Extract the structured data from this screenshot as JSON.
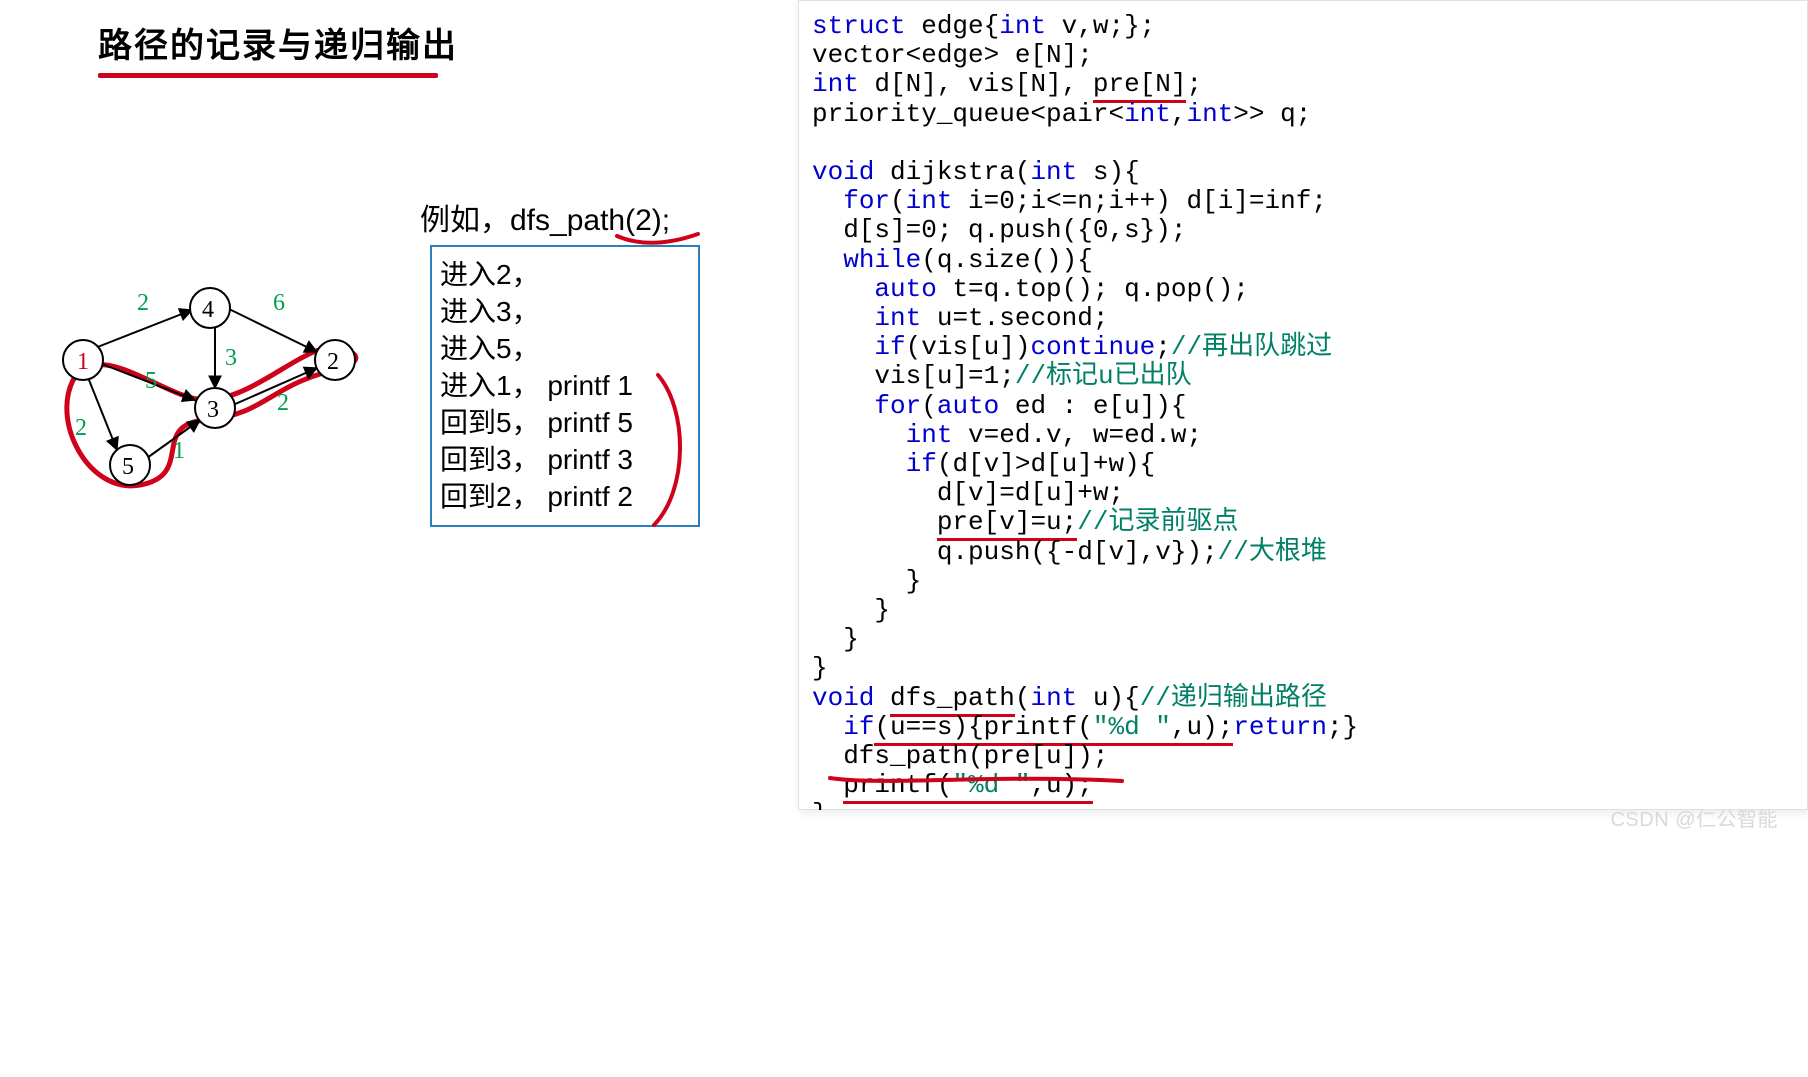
{
  "title": "路径的记录与递归输出",
  "example_label": "例如，dfs_path(2);",
  "trace": {
    "l1": "进入2，",
    "l2": "进入3，",
    "l3": "进入5，",
    "l4": "进入1， printf 1",
    "l5": "回到5， printf 5",
    "l6": "回到3， printf 3",
    "l7": "回到2， printf 2"
  },
  "graph": {
    "nodes": {
      "1": "1",
      "2": "2",
      "3": "3",
      "4": "4",
      "5": "5"
    },
    "weights": {
      "e14": "2",
      "e42": "6",
      "e43": "3",
      "e13": "5",
      "e15": "2",
      "e53": "1",
      "e32": "2"
    }
  },
  "code": {
    "l01a": "struct",
    "l01b": " edge{",
    "l01c": "int",
    "l01d": " v,w;};",
    "l02a": "vector<edge> e[N];",
    "l03a": "int",
    "l03b": " d[N], vis[N], ",
    "l03c": "pre[N]",
    "l03d": ";",
    "l04a": "priority_queue<pair<",
    "l04b": "int",
    "l04c": ",",
    "l04d": "int",
    "l04e": ">> q;",
    "l06a": "void",
    "l06b": " dijkstra(",
    "l06c": "int",
    "l06d": " s){",
    "l07a": "  ",
    "l07b": "for",
    "l07c": "(",
    "l07d": "int",
    "l07e": " i=0;i<=n;i++) d[i]=inf;",
    "l08a": "  d[s]=0; q.push({0,s});",
    "l09a": "  ",
    "l09b": "while",
    "l09c": "(q.size()){",
    "l10a": "    ",
    "l10b": "auto",
    "l10c": " t=q.top(); q.pop();",
    "l11a": "    ",
    "l11b": "int",
    "l11c": " u=t.second;",
    "l12a": "    ",
    "l12b": "if",
    "l12c": "(vis[u])",
    "l12d": "continue",
    "l12e": ";",
    "l12f": "//再出队跳过",
    "l13a": "    vis[u]=1;",
    "l13b": "//标记u已出队",
    "l14a": "    ",
    "l14b": "for",
    "l14c": "(",
    "l14d": "auto",
    "l14e": " ed : e[u]){",
    "l15a": "      ",
    "l15b": "int",
    "l15c": " v=ed.v, w=ed.w;",
    "l16a": "      ",
    "l16b": "if",
    "l16c": "(d[v]>d[u]+w){",
    "l17a": "        d[v]=d[u]+w;",
    "l18a": "        ",
    "l18b": "pre[v]=u;",
    "l18c": "//记录前驱点",
    "l19a": "        q.push({-d[v],v});",
    "l19b": "//大根堆",
    "l20a": "      }",
    "l21a": "    }",
    "l22a": "  }",
    "l23a": "}",
    "l24a": "void",
    "l24b": " ",
    "l24c": "dfs_path",
    "l24d": "(",
    "l24e": "int",
    "l24f": " u){",
    "l24g": "//递归输出路径",
    "l25a": "  ",
    "l25b": "if",
    "l25c": "(u==s)",
    "l25d": "{printf(",
    "l25e": "\"%d \"",
    "l25f": ",u);",
    "l25g": "return",
    "l25h": ";}",
    "l26a": "  dfs_path(pre[u]);",
    "l27a": "  ",
    "l27b": "printf(",
    "l27c": "\"%d \"",
    "l27d": ",u);",
    "l28a": "}"
  },
  "watermark": "CSDN @仁公智能"
}
